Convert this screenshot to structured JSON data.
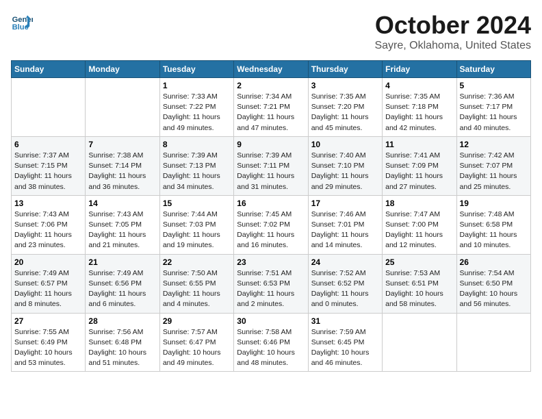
{
  "header": {
    "logo_line1": "General",
    "logo_line2": "Blue",
    "title": "October 2024",
    "subtitle": "Sayre, Oklahoma, United States"
  },
  "weekdays": [
    "Sunday",
    "Monday",
    "Tuesday",
    "Wednesday",
    "Thursday",
    "Friday",
    "Saturday"
  ],
  "weeks": [
    [
      {
        "day": "",
        "info": ""
      },
      {
        "day": "",
        "info": ""
      },
      {
        "day": "1",
        "info": "Sunrise: 7:33 AM\nSunset: 7:22 PM\nDaylight: 11 hours and 49 minutes."
      },
      {
        "day": "2",
        "info": "Sunrise: 7:34 AM\nSunset: 7:21 PM\nDaylight: 11 hours and 47 minutes."
      },
      {
        "day": "3",
        "info": "Sunrise: 7:35 AM\nSunset: 7:20 PM\nDaylight: 11 hours and 45 minutes."
      },
      {
        "day": "4",
        "info": "Sunrise: 7:35 AM\nSunset: 7:18 PM\nDaylight: 11 hours and 42 minutes."
      },
      {
        "day": "5",
        "info": "Sunrise: 7:36 AM\nSunset: 7:17 PM\nDaylight: 11 hours and 40 minutes."
      }
    ],
    [
      {
        "day": "6",
        "info": "Sunrise: 7:37 AM\nSunset: 7:15 PM\nDaylight: 11 hours and 38 minutes."
      },
      {
        "day": "7",
        "info": "Sunrise: 7:38 AM\nSunset: 7:14 PM\nDaylight: 11 hours and 36 minutes."
      },
      {
        "day": "8",
        "info": "Sunrise: 7:39 AM\nSunset: 7:13 PM\nDaylight: 11 hours and 34 minutes."
      },
      {
        "day": "9",
        "info": "Sunrise: 7:39 AM\nSunset: 7:11 PM\nDaylight: 11 hours and 31 minutes."
      },
      {
        "day": "10",
        "info": "Sunrise: 7:40 AM\nSunset: 7:10 PM\nDaylight: 11 hours and 29 minutes."
      },
      {
        "day": "11",
        "info": "Sunrise: 7:41 AM\nSunset: 7:09 PM\nDaylight: 11 hours and 27 minutes."
      },
      {
        "day": "12",
        "info": "Sunrise: 7:42 AM\nSunset: 7:07 PM\nDaylight: 11 hours and 25 minutes."
      }
    ],
    [
      {
        "day": "13",
        "info": "Sunrise: 7:43 AM\nSunset: 7:06 PM\nDaylight: 11 hours and 23 minutes."
      },
      {
        "day": "14",
        "info": "Sunrise: 7:43 AM\nSunset: 7:05 PM\nDaylight: 11 hours and 21 minutes."
      },
      {
        "day": "15",
        "info": "Sunrise: 7:44 AM\nSunset: 7:03 PM\nDaylight: 11 hours and 19 minutes."
      },
      {
        "day": "16",
        "info": "Sunrise: 7:45 AM\nSunset: 7:02 PM\nDaylight: 11 hours and 16 minutes."
      },
      {
        "day": "17",
        "info": "Sunrise: 7:46 AM\nSunset: 7:01 PM\nDaylight: 11 hours and 14 minutes."
      },
      {
        "day": "18",
        "info": "Sunrise: 7:47 AM\nSunset: 7:00 PM\nDaylight: 11 hours and 12 minutes."
      },
      {
        "day": "19",
        "info": "Sunrise: 7:48 AM\nSunset: 6:58 PM\nDaylight: 11 hours and 10 minutes."
      }
    ],
    [
      {
        "day": "20",
        "info": "Sunrise: 7:49 AM\nSunset: 6:57 PM\nDaylight: 11 hours and 8 minutes."
      },
      {
        "day": "21",
        "info": "Sunrise: 7:49 AM\nSunset: 6:56 PM\nDaylight: 11 hours and 6 minutes."
      },
      {
        "day": "22",
        "info": "Sunrise: 7:50 AM\nSunset: 6:55 PM\nDaylight: 11 hours and 4 minutes."
      },
      {
        "day": "23",
        "info": "Sunrise: 7:51 AM\nSunset: 6:53 PM\nDaylight: 11 hours and 2 minutes."
      },
      {
        "day": "24",
        "info": "Sunrise: 7:52 AM\nSunset: 6:52 PM\nDaylight: 11 hours and 0 minutes."
      },
      {
        "day": "25",
        "info": "Sunrise: 7:53 AM\nSunset: 6:51 PM\nDaylight: 10 hours and 58 minutes."
      },
      {
        "day": "26",
        "info": "Sunrise: 7:54 AM\nSunset: 6:50 PM\nDaylight: 10 hours and 56 minutes."
      }
    ],
    [
      {
        "day": "27",
        "info": "Sunrise: 7:55 AM\nSunset: 6:49 PM\nDaylight: 10 hours and 53 minutes."
      },
      {
        "day": "28",
        "info": "Sunrise: 7:56 AM\nSunset: 6:48 PM\nDaylight: 10 hours and 51 minutes."
      },
      {
        "day": "29",
        "info": "Sunrise: 7:57 AM\nSunset: 6:47 PM\nDaylight: 10 hours and 49 minutes."
      },
      {
        "day": "30",
        "info": "Sunrise: 7:58 AM\nSunset: 6:46 PM\nDaylight: 10 hours and 48 minutes."
      },
      {
        "day": "31",
        "info": "Sunrise: 7:59 AM\nSunset: 6:45 PM\nDaylight: 10 hours and 46 minutes."
      },
      {
        "day": "",
        "info": ""
      },
      {
        "day": "",
        "info": ""
      }
    ]
  ]
}
